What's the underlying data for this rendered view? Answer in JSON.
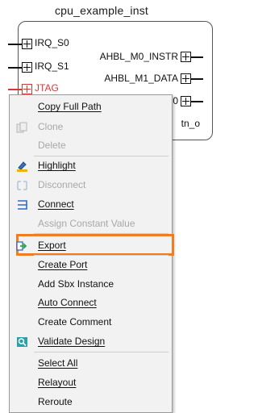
{
  "block": {
    "title": "cpu_example_inst",
    "left_ports": [
      "IRQ_S0",
      "IRQ_S1",
      "JTAG"
    ],
    "right_ports": [
      "AHBL_M0_INSTR",
      "AHBL_M1_DATA",
      "M0",
      "tn_o"
    ]
  },
  "menu": {
    "items": [
      {
        "label": "Copy Full Path",
        "enabled": true,
        "icon": null
      },
      {
        "label": "Clone",
        "enabled": false,
        "icon": "clone-icon"
      },
      {
        "label": "Delete",
        "enabled": false,
        "icon": null
      },
      {
        "label": "Highlight",
        "enabled": true,
        "icon": "highlight-icon"
      },
      {
        "label": "Disconnect",
        "enabled": false,
        "icon": "disconnect-icon"
      },
      {
        "label": "Connect",
        "enabled": true,
        "icon": "connect-icon"
      },
      {
        "label": "Assign Constant Value",
        "enabled": false,
        "icon": null
      },
      {
        "label": "Export",
        "enabled": true,
        "icon": "export-icon",
        "highlighted": true
      },
      {
        "label": "Create Port",
        "enabled": true,
        "icon": null
      },
      {
        "label": "Add Sbx Instance",
        "enabled": true,
        "icon": null
      },
      {
        "label": "Auto Connect",
        "enabled": true,
        "icon": null
      },
      {
        "label": "Create Comment",
        "enabled": true,
        "icon": null
      },
      {
        "label": "Validate Design",
        "enabled": true,
        "icon": "validate-icon"
      },
      {
        "label": "Select All",
        "enabled": true,
        "icon": null
      },
      {
        "label": "Relayout",
        "enabled": true,
        "icon": null
      },
      {
        "label": "Reroute",
        "enabled": true,
        "icon": null
      }
    ]
  },
  "colors": {
    "highlight_border": "#ee7d23",
    "disabled_text": "#a8a8a8",
    "port_red": "#d23a3a"
  }
}
